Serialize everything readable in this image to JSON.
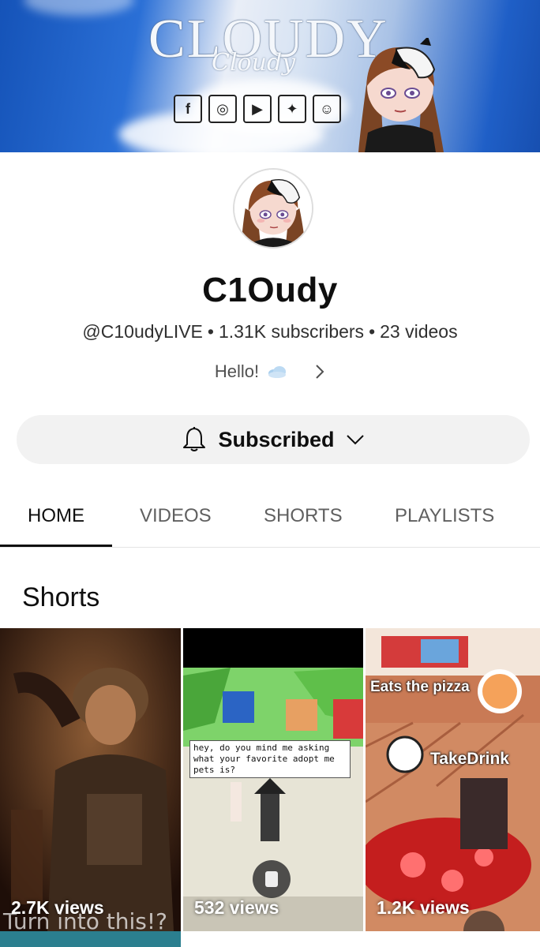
{
  "banner": {
    "title": "CLOUDY",
    "script": "Cloudy",
    "social_icons": [
      "facebook-icon",
      "instagram-icon",
      "youtube-icon",
      "twitter-icon",
      "snapchat-icon"
    ],
    "social_glyphs": [
      "f",
      "◎",
      "▶",
      "✦",
      "☺"
    ]
  },
  "channel": {
    "name": "C1Oudy",
    "handle": "@C10udyLIVE",
    "subscribers": "1.31K subscribers",
    "videos": "23 videos",
    "about": "Hello!"
  },
  "subscribe": {
    "label": "Subscribed"
  },
  "tabs": [
    {
      "label": "HOME",
      "active": true
    },
    {
      "label": "VIDEOS",
      "active": false
    },
    {
      "label": "SHORTS",
      "active": false
    },
    {
      "label": "PLAYLISTS",
      "active": false
    }
  ],
  "section": {
    "title": "Shorts"
  },
  "shorts": [
    {
      "views": "2.7K views",
      "caption": "Turn into this!?"
    },
    {
      "views": "532 views",
      "caption": "hey, do you mind me asking what your favorite adopt me pets is?"
    },
    {
      "views": "1.2K views",
      "caption": "Eats the pizza",
      "caption2": "TakeDrink"
    }
  ],
  "colors": {
    "accent": "#0f0f0f",
    "muted": "#606060",
    "button_bg": "#f2f2f2"
  }
}
